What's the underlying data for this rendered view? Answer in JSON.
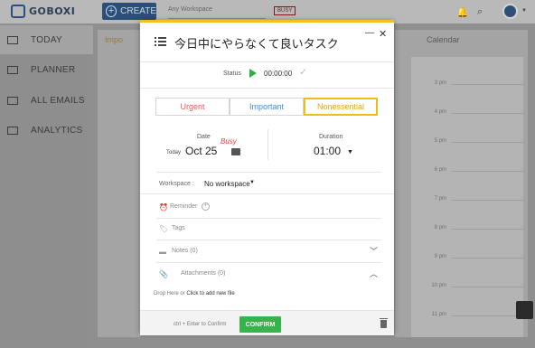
{
  "app": {
    "logo_text": "GOBOXI",
    "create_label": "CREATE",
    "workspace_placeholder": "Any Workspace",
    "busy_badge": "BUSY"
  },
  "sidebar": {
    "items": [
      {
        "label": "TODAY",
        "icon": "today-icon",
        "active": true
      },
      {
        "label": "PLANNER",
        "icon": "planner-icon"
      },
      {
        "label": "ALL EMAILS",
        "icon": "mail-icon"
      },
      {
        "label": "ANALYTICS",
        "icon": "analytics-icon"
      }
    ]
  },
  "background": {
    "column_label": "Impo",
    "calendar_label": "Calendar",
    "times": [
      "3 pm",
      "4 pm",
      "5 pm",
      "6 pm",
      "7 pm",
      "8 pm",
      "9 pm",
      "10 pm",
      "11 pm"
    ]
  },
  "task": {
    "title": "今日中にやらなくて良いタスク",
    "status_label": "Status",
    "timer": "00:00:00",
    "priorities": {
      "urgent": "Urgent",
      "important": "Important",
      "nonessential": "Nonessential",
      "selected": "nonessential"
    },
    "date_label": "Date",
    "today_label": "Today",
    "date_value": "Oct 25",
    "busy_text": "Busy",
    "duration_label": "Duration",
    "duration_value": "01:00",
    "workspace_label": "Workspace :",
    "workspace_value": "No workspace",
    "reminder_label": "Reminder",
    "tags_label": "Tags",
    "notes_label": "Notes (0)",
    "attachments_label": "Attachments (0)",
    "drop_text": "Drop Here or",
    "drop_link": "Click to add new file",
    "shortcut_hint": "ctrl + Enter to Confirm",
    "confirm_label": "CONFIRM"
  },
  "colors": {
    "accent": "#f3c01c",
    "urgent": "#e05a5a",
    "important": "#3e8ed8",
    "nonessential": "#e3a60d",
    "confirm": "#36b34a"
  }
}
